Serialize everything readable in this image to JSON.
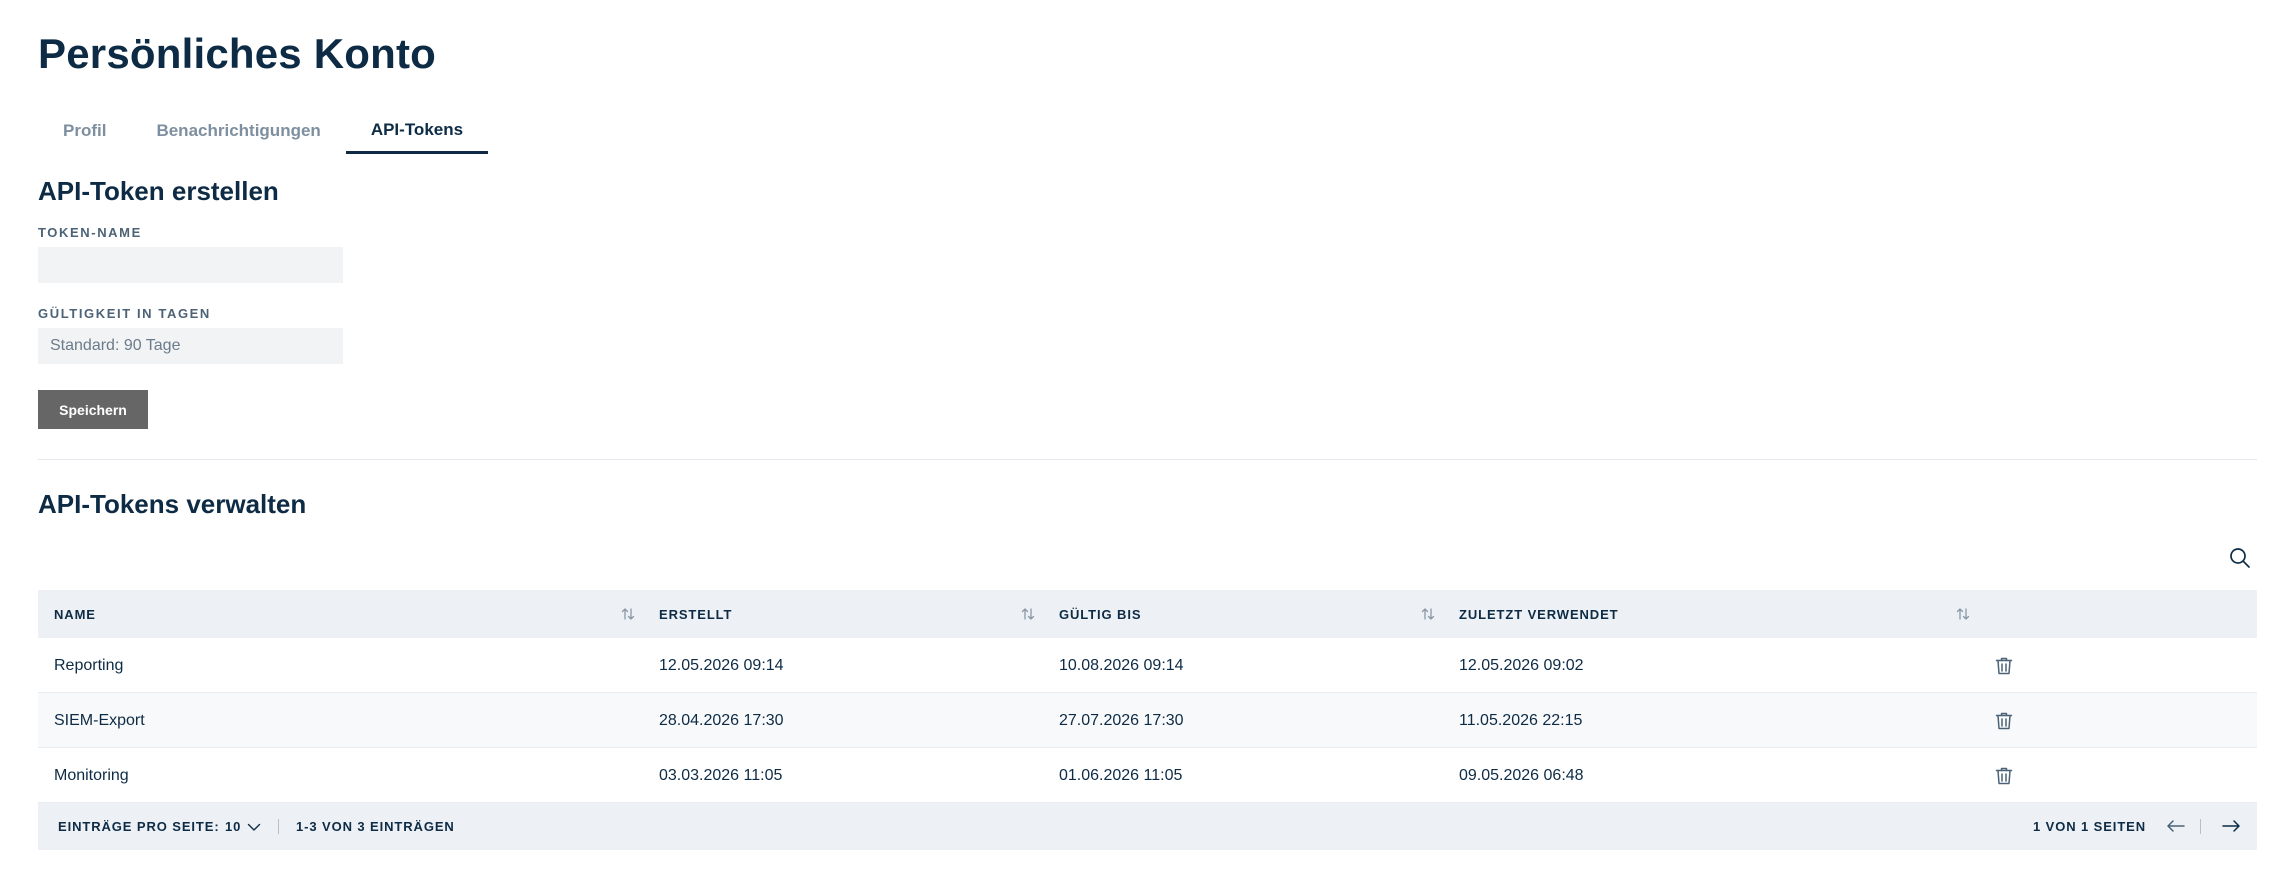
{
  "page": {
    "title": "Persönliches Konto"
  },
  "tabs": [
    {
      "label": "Profil"
    },
    {
      "label": "Benachrichtigungen"
    },
    {
      "label": "API-Tokens"
    }
  ],
  "create_section": {
    "title": "API-Token erstellen",
    "token_name_label": "TOKEN-NAME",
    "token_name_value": "",
    "token_name_placeholder": "",
    "validity_label": "GÜLTIGKEIT IN TAGEN",
    "validity_value": "",
    "validity_placeholder": "Standard: 90 Tage",
    "save_label": "Speichern"
  },
  "manage_section": {
    "title": "API-Tokens verwalten",
    "columns": {
      "name": "NAME",
      "created": "ERSTELLT",
      "valid_until": "GÜLTIG BIS",
      "last_used": "ZULETZT VERWENDET"
    },
    "rows": [
      {
        "name": "Reporting",
        "created": "12.05.2026 09:14",
        "valid_until": "10.08.2026 09:14",
        "last_used": "12.05.2026 09:02"
      },
      {
        "name": "SIEM-Export",
        "created": "28.04.2026 17:30",
        "valid_until": "27.07.2026 17:30",
        "last_used": "11.05.2026 22:15"
      },
      {
        "name": "Monitoring",
        "created": "03.03.2026 11:05",
        "valid_until": "01.06.2026 11:05",
        "last_used": "09.05.2026 06:48"
      }
    ],
    "footer": {
      "per_page_label": "EINTRÄGE PRO SEITE:",
      "per_page_value": "10",
      "range_text": "1-3 VON 3 EINTRÄGEN",
      "page_text": "1 VON 1 SEITEN"
    }
  },
  "icons": {
    "search": "search-icon",
    "sort": "sort-icon",
    "delete": "trash-icon",
    "prev": "arrow-left-icon",
    "next": "arrow-right-icon",
    "dropdown": "chevron-down-icon"
  },
  "colors": {
    "primary_text": "#0d2b45",
    "muted_text": "#7e8fa0",
    "header_bg": "#edf1f5",
    "button_bg": "#666666",
    "input_bg": "#f1f3f5"
  }
}
